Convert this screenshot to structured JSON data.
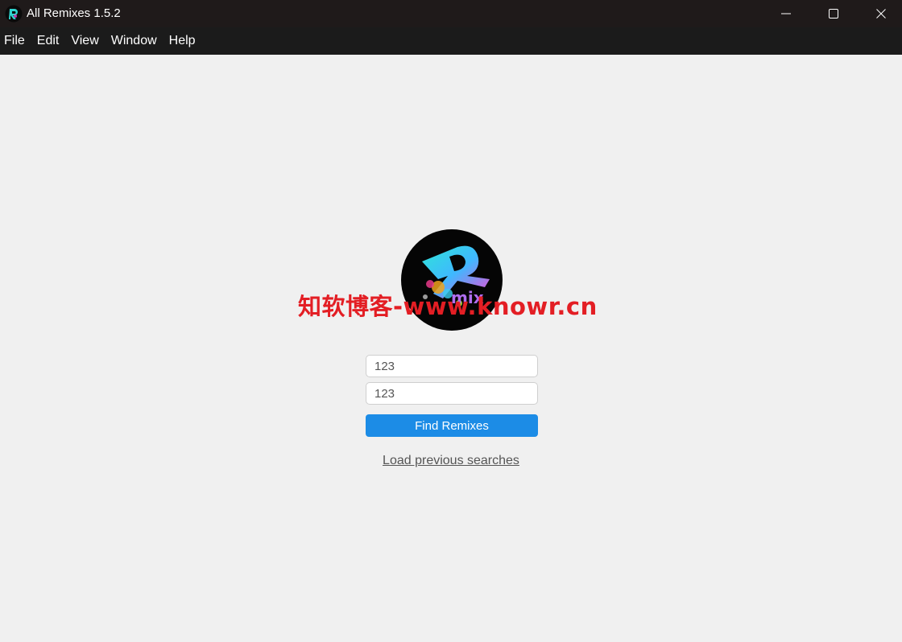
{
  "window": {
    "title": "All Remixes 1.5.2"
  },
  "menu": {
    "items": [
      "File",
      "Edit",
      "View",
      "Window",
      "Help"
    ]
  },
  "logo": {
    "text": "mix",
    "letter": "R"
  },
  "watermark": {
    "text": "知软博客-www.knowr.cn"
  },
  "search": {
    "field1_value": "123",
    "field2_value": "123",
    "find_button_label": "Find Remixes",
    "load_previous_label": "Load previous searches"
  },
  "colors": {
    "titlebar": "#1f1a1a",
    "menubar": "#1b1b1b",
    "background": "#f0f0f0",
    "accent": "#1c8ce6",
    "watermark": "#e31e24"
  }
}
